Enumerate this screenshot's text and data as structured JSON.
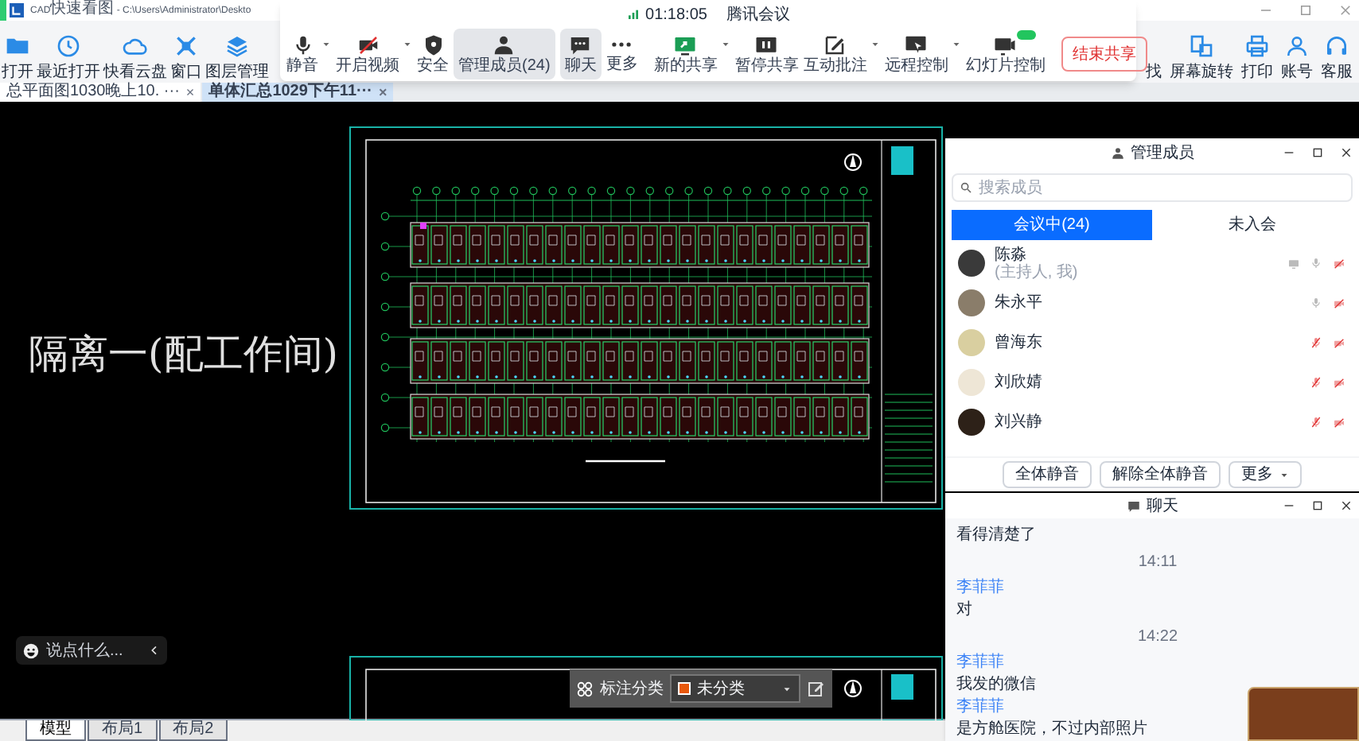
{
  "cad_app": {
    "title": "CAD快速看图 - C:\\Users\\Administrator\\Deskto",
    "toolbar_left": [
      {
        "label": "打开",
        "kind": "folder"
      },
      {
        "label": "最近打开",
        "kind": "clock"
      },
      {
        "label": "快看云盘",
        "kind": "cloud"
      },
      {
        "label": "窗口",
        "kind": "window"
      },
      {
        "label": "图层管理",
        "kind": "layers"
      }
    ],
    "toolbar_right": [
      {
        "label": "找",
        "kind": "none"
      },
      {
        "label": "屏幕旋转",
        "kind": "rotate"
      },
      {
        "label": "打印",
        "kind": "printer"
      },
      {
        "label": "账号",
        "kind": "person"
      },
      {
        "label": "客服",
        "kind": "headset"
      }
    ],
    "file_tabs": [
      {
        "label": "总平面图1030晚上10. ···",
        "close": "×",
        "selected": false
      },
      {
        "label": "单体汇总1029下午11···",
        "close": "×",
        "selected": true
      }
    ],
    "canvas": {
      "drawing_label": "隔离一(配工作间)",
      "chat_input": {
        "placeholder": "说点什么..."
      }
    },
    "annotation_bar": {
      "label": "标注分类",
      "category": "未分类"
    },
    "layout_tabs": [
      {
        "label": "模型",
        "selected": true
      },
      {
        "label": "布局1",
        "selected": false
      },
      {
        "label": "布局2",
        "selected": false
      }
    ]
  },
  "meeting_bar": {
    "timer": "01:18:05",
    "title": "腾讯会议",
    "buttons": [
      {
        "label": "静音",
        "kind": "mic",
        "dropdown": true,
        "active": false,
        "badge": false
      },
      {
        "label": "开启视频",
        "kind": "video",
        "dropdown": true,
        "active": false,
        "badge": false
      },
      {
        "label": "安全",
        "kind": "shield",
        "dropdown": false,
        "active": false,
        "badge": false
      },
      {
        "label": "管理成员(24)",
        "kind": "people",
        "dropdown": false,
        "active": true,
        "badge": false
      },
      {
        "label": "聊天",
        "kind": "chat",
        "dropdown": false,
        "active": true,
        "badge": false
      },
      {
        "label": "更多",
        "kind": "dots",
        "dropdown": false,
        "active": false,
        "badge": false
      },
      {
        "label": "新的共享",
        "kind": "share",
        "dropdown": true,
        "active": false,
        "badge": false
      },
      {
        "label": "暂停共享",
        "kind": "pause",
        "dropdown": false,
        "active": false,
        "badge": false
      },
      {
        "label": "互动批注",
        "kind": "annotate",
        "dropdown": true,
        "active": false,
        "badge": false
      },
      {
        "label": "远程控制",
        "kind": "remote",
        "dropdown": true,
        "active": false,
        "badge": false
      },
      {
        "label": "幻灯片控制",
        "kind": "slides",
        "dropdown": false,
        "active": false,
        "badge": true
      }
    ],
    "end_share": "结束共享"
  },
  "members_panel": {
    "title": "管理成员",
    "search": {
      "placeholder": "搜索成员"
    },
    "tabs": [
      {
        "label": "会议中(24)",
        "selected": true
      },
      {
        "label": "未入会",
        "selected": false
      }
    ],
    "members": [
      {
        "name": "陈淼",
        "note": "(主持人, 我)",
        "screen": true,
        "mic_muted": false,
        "video_off": true
      },
      {
        "name": "朱永平",
        "screen": false,
        "mic_muted": false,
        "video_off": true
      },
      {
        "name": "曾海东",
        "screen": false,
        "mic_muted": true,
        "video_off": true
      },
      {
        "name": "刘欣婧",
        "screen": false,
        "mic_muted": true,
        "video_off": true
      },
      {
        "name": "刘兴静",
        "screen": false,
        "mic_muted": true,
        "video_off": true
      }
    ],
    "buttons": [
      "全体静音",
      "解除全体静音",
      "更多"
    ]
  },
  "chat_panel": {
    "title": "聊天",
    "messages": [
      {
        "kind": "text",
        "text": "看得清楚了"
      },
      {
        "kind": "time",
        "text": "14:11"
      },
      {
        "kind": "sender",
        "text": "李菲菲"
      },
      {
        "kind": "text",
        "text": "对"
      },
      {
        "kind": "time",
        "text": "14:22"
      },
      {
        "kind": "sender",
        "text": "李菲菲"
      },
      {
        "kind": "text",
        "text": "我发的微信"
      },
      {
        "kind": "sender",
        "text": "李菲菲"
      },
      {
        "kind": "text",
        "text": "是方舱医院，不过内部照片"
      }
    ]
  }
}
